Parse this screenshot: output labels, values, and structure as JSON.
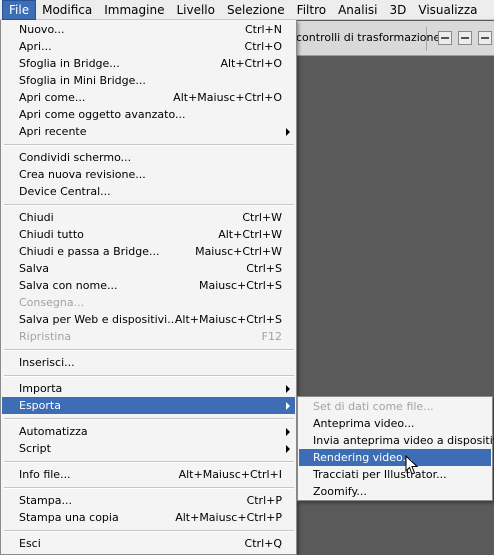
{
  "menubar": {
    "items": [
      "File",
      "Modifica",
      "Immagine",
      "Livello",
      "Selezione",
      "Filtro",
      "Analisi",
      "3D",
      "Visualizza"
    ],
    "active": "File"
  },
  "options_bar": {
    "transform_label": "controlli di trasformazione"
  },
  "file_menu": {
    "groups": [
      [
        {
          "label": "Nuovo...",
          "shortcut": "Ctrl+N"
        },
        {
          "label": "Apri...",
          "shortcut": "Ctrl+O"
        },
        {
          "label": "Sfoglia in Bridge...",
          "shortcut": "Alt+Ctrl+O"
        },
        {
          "label": "Sfoglia in Mini Bridge...",
          "shortcut": ""
        },
        {
          "label": "Apri come...",
          "shortcut": "Alt+Maiusc+Ctrl+O"
        },
        {
          "label": "Apri come oggetto avanzato...",
          "shortcut": ""
        },
        {
          "label": "Apri recente",
          "shortcut": "",
          "submenu": true
        }
      ],
      [
        {
          "label": "Condividi schermo...",
          "shortcut": ""
        },
        {
          "label": "Crea nuova revisione...",
          "shortcut": ""
        },
        {
          "label": "Device Central...",
          "shortcut": ""
        }
      ],
      [
        {
          "label": "Chiudi",
          "shortcut": "Ctrl+W"
        },
        {
          "label": "Chiudi tutto",
          "shortcut": "Alt+Ctrl+W"
        },
        {
          "label": "Chiudi e passa a Bridge...",
          "shortcut": "Maiusc+Ctrl+W"
        },
        {
          "label": "Salva",
          "shortcut": "Ctrl+S"
        },
        {
          "label": "Salva con nome...",
          "shortcut": "Maiusc+Ctrl+S"
        },
        {
          "label": "Consegna...",
          "shortcut": "",
          "disabled": true
        },
        {
          "label": "Salva per Web e dispositivi...",
          "shortcut": "Alt+Maiusc+Ctrl+S"
        },
        {
          "label": "Ripristina",
          "shortcut": "F12",
          "disabled": true
        }
      ],
      [
        {
          "label": "Inserisci...",
          "shortcut": ""
        }
      ],
      [
        {
          "label": "Importa",
          "shortcut": "",
          "submenu": true
        },
        {
          "label": "Esporta",
          "shortcut": "",
          "submenu": true,
          "highlight": true
        }
      ],
      [
        {
          "label": "Automatizza",
          "shortcut": "",
          "submenu": true
        },
        {
          "label": "Script",
          "shortcut": "",
          "submenu": true
        }
      ],
      [
        {
          "label": "Info file...",
          "shortcut": "Alt+Maiusc+Ctrl+I"
        }
      ],
      [
        {
          "label": "Stampa...",
          "shortcut": "Ctrl+P"
        },
        {
          "label": "Stampa una copia",
          "shortcut": "Alt+Maiusc+Ctrl+P"
        }
      ],
      [
        {
          "label": "Esci",
          "shortcut": "Ctrl+Q"
        }
      ]
    ]
  },
  "export_submenu": {
    "items": [
      {
        "label": "Set di dati come file...",
        "disabled": true
      },
      {
        "label": "Anteprima video..."
      },
      {
        "label": "Invia anteprima video a dispositivo"
      },
      {
        "label": "Rendering video...",
        "highlight": true
      },
      {
        "label": "Tracciati per Illustrator..."
      },
      {
        "label": "Zoomify..."
      }
    ]
  },
  "colors": {
    "highlight": "#3d6db5",
    "menu_bg": "#f4f4f4",
    "disabled_text": "#a3a3a3",
    "canvas": "#5a5a5a"
  }
}
